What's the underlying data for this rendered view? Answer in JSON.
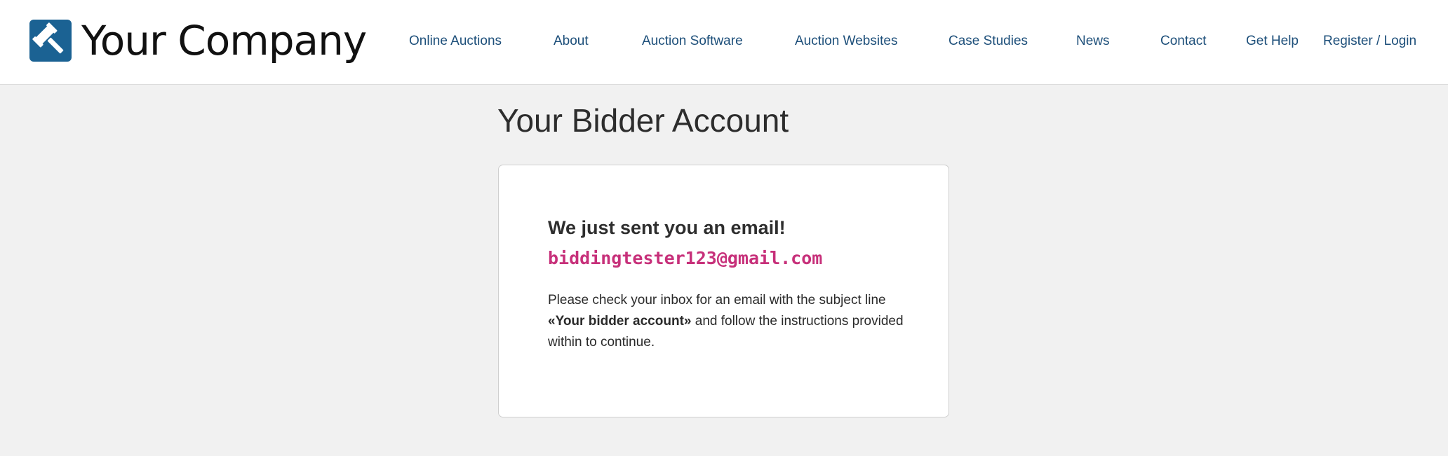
{
  "header": {
    "logo_text": "Your Company",
    "nav": [
      {
        "label": "Online Auctions"
      },
      {
        "label": "About"
      },
      {
        "label": "Auction Software"
      },
      {
        "label": "Auction Websites"
      },
      {
        "label": "Case Studies"
      },
      {
        "label": "News"
      },
      {
        "label": "Contact"
      },
      {
        "label": "Get Help"
      },
      {
        "label": "Register / Login"
      }
    ]
  },
  "main": {
    "title": "Your Bidder Account",
    "card": {
      "heading": "We just sent you an email!",
      "email": "biddingtester123@gmail.com",
      "text_before": "Please check your inbox for an email with the subject line",
      "subject": "«Your bidder account»",
      "text_after": " and follow the instructions provided within to continue."
    }
  },
  "colors": {
    "brand": "#1b6293",
    "nav_link": "#1d4f7a",
    "email_accent": "#c7307a",
    "page_bg": "#f1f1f1"
  },
  "icons": {
    "logo": "gavel-icon"
  }
}
